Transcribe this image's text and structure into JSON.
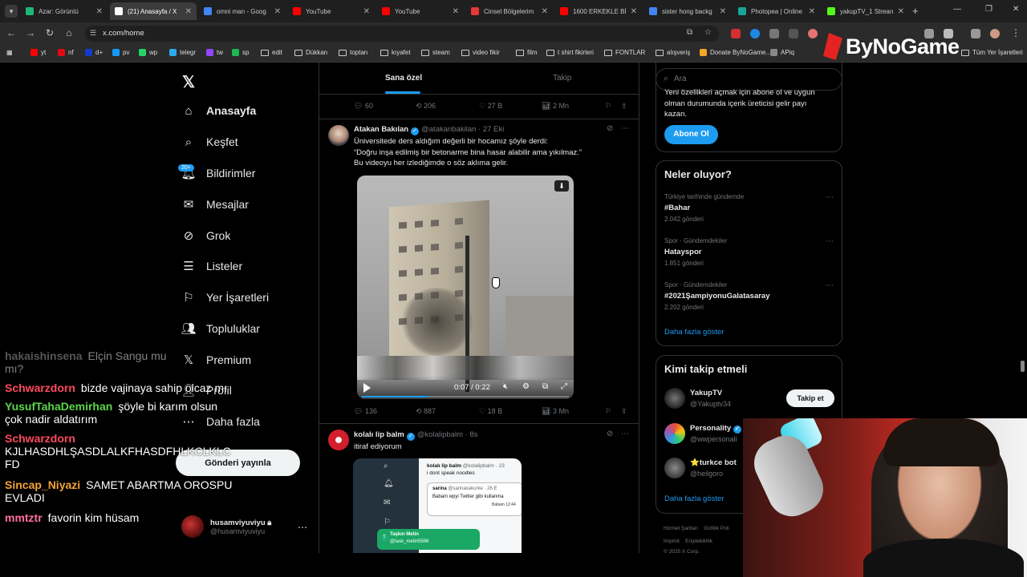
{
  "browser": {
    "tabs": [
      {
        "title": "Azar: Görüntü",
        "icon_color": "#1fb676",
        "active": false
      },
      {
        "title": "(21) Anasayfa / X",
        "icon_color": "#ffffff",
        "active": true
      },
      {
        "title": "omni man - Goog",
        "icon_color": "#4285f4",
        "active": false
      },
      {
        "title": "YouTube",
        "icon_color": "#ff0000",
        "active": false
      },
      {
        "title": "YouTube",
        "icon_color": "#ff0000",
        "active": false
      },
      {
        "title": "Cinsel Bölgelerim",
        "icon_color": "#e53935",
        "active": false
      },
      {
        "title": "1600 ERKEKLE Bİ",
        "icon_color": "#ff0000",
        "active": false
      },
      {
        "title": "sister hong backg",
        "icon_color": "#4285f4",
        "active": false
      },
      {
        "title": "Photopea | Online",
        "icon_color": "#18a497",
        "active": false
      },
      {
        "title": "yakupTV_1 Strean",
        "icon_color": "#53fc18",
        "active": false
      }
    ],
    "url": "x.com/home",
    "bookmarks": [
      {
        "label": "yt",
        "type": "icon",
        "color": "#ff0000"
      },
      {
        "label": "nf",
        "type": "icon",
        "color": "#e50914"
      },
      {
        "label": "d+",
        "type": "icon",
        "color": "#113ccf"
      },
      {
        "label": "pv",
        "type": "icon",
        "color": "#1399ff"
      },
      {
        "label": "wp",
        "type": "icon",
        "color": "#25d366"
      },
      {
        "label": "telegr",
        "type": "icon",
        "color": "#2aabee"
      },
      {
        "label": "tw",
        "type": "icon",
        "color": "#9146ff"
      },
      {
        "label": "sp",
        "type": "icon",
        "color": "#1db954"
      },
      {
        "label": "edit",
        "type": "folder"
      },
      {
        "label": "Dükkan",
        "type": "folder"
      },
      {
        "label": "toptan",
        "type": "folder"
      },
      {
        "label": "kıyafet",
        "type": "folder"
      },
      {
        "label": "steam",
        "type": "folder"
      },
      {
        "label": "video fikir",
        "type": "folder"
      },
      {
        "label": "film",
        "type": "folder"
      },
      {
        "label": "t shirt fikirleri",
        "type": "folder"
      },
      {
        "label": "FONTLAR",
        "type": "folder"
      },
      {
        "label": "alışveriş",
        "type": "folder"
      },
      {
        "label": "Donate ByNoGame...",
        "type": "icon",
        "color": "#f5a623"
      },
      {
        "label": "APiq",
        "type": "icon",
        "color": "#888888"
      }
    ],
    "all_bookmarks": "Tüm Yer İşaretleri",
    "overlay_logo": "ByNoGame"
  },
  "nav": {
    "items": [
      {
        "label": "Anasayfa",
        "icon": "home-icon",
        "glyph": "⌂",
        "bold": true
      },
      {
        "label": "Keşfet",
        "icon": "search-icon",
        "glyph": "⌕"
      },
      {
        "label": "Bildirimler",
        "icon": "bell-icon",
        "glyph": "🔔︎"
      },
      {
        "label": "Mesajlar",
        "icon": "mail-icon",
        "glyph": "✉"
      },
      {
        "label": "Grok",
        "icon": "grok-icon",
        "glyph": "⊘"
      },
      {
        "label": "Listeler",
        "icon": "list-icon",
        "glyph": "☰"
      },
      {
        "label": "Yer İşaretleri",
        "icon": "bookmark-icon",
        "glyph": "⚐"
      },
      {
        "label": "Topluluklar",
        "icon": "communities-icon",
        "glyph": "👥︎"
      },
      {
        "label": "Premium",
        "icon": "x-premium-icon",
        "glyph": "𝕏"
      },
      {
        "label": "Profil",
        "icon": "profile-icon",
        "glyph": "👤︎"
      },
      {
        "label": "Daha fazla",
        "icon": "more-icon",
        "glyph": "⋯"
      }
    ],
    "badge": "20+",
    "post_button": "Gönderi yayınla",
    "account": {
      "name": "husamviyuviyu",
      "handle": "@husamviyuviyu"
    }
  },
  "timeline": {
    "tabs": [
      "Sana özel",
      "Takip"
    ],
    "prev_actions": {
      "replies": "60",
      "reposts": "206",
      "likes": "27 B",
      "views": "2 Mn"
    },
    "tweet1": {
      "name": "Atakan Bakılan",
      "handle": "@atakanbakilan",
      "time": "· 27 Eki",
      "lines": [
        "Üniversitede ders aldığım değerli bir hocamız şöyle derdi:",
        "“Doğru inşa edilmiş bir betonarme bina hasar alabilir ama yıkılmaz.”",
        "Bu videoyu her izlediğimde o söz aklıma gelir."
      ],
      "video_time": "0:07 / 0:22",
      "video_progress": 0.32,
      "actions": {
        "replies": "136",
        "reposts": "887",
        "likes": "18 B",
        "views": "3 Mn"
      }
    },
    "tweet2": {
      "name": "kolalı lip balm",
      "handle": "@kolalipbalm",
      "time": "· 8s",
      "text": "itiraf ediyorum",
      "shot": {
        "name": "kolalı lip balm",
        "handle": "@kolalipbalm · 23",
        "line": "i dont speak noodles",
        "inner_name": "sarina",
        "inner_handle": "@sarinaxakurke · 26 E",
        "inner_text": "Babam wpyi Twitter gibi kullanma",
        "chat_name": "Taşkın Metin",
        "chat_handle": "@task_metin5596",
        "chat_initial": "T",
        "side_label_1": "Babam",
        "side_label_2": "12:44"
      }
    }
  },
  "right": {
    "search_placeholder": "Ara",
    "premium": {
      "lines": [
        "Yeni özellikleri açmak için abone ol ve uygun",
        "olman durumunda içerik üreticisi gelir payı",
        "kazan."
      ],
      "button": "Abone Ol"
    },
    "trends": {
      "title": "Neler oluyor?",
      "items": [
        {
          "context": "Türkiye tarihinde gündemde",
          "topic": "#Bahar",
          "count": "2.042 gönderi"
        },
        {
          "context": "Spor · Gündemdekiler",
          "topic": "Hatayspor",
          "count": "1.851 gönderi"
        },
        {
          "context": "Spor · Gündemdekiler",
          "topic": "#2021ŞampiyonuGalatasaray",
          "count": "2.202 gönderi"
        }
      ],
      "more": "Daha fazla göster"
    },
    "who_to_follow": {
      "title": "Kimi takip etmeli",
      "items": [
        {
          "name": "YakupTV",
          "handle": "@Yakuptv34",
          "button": "Takip et"
        },
        {
          "name": "Personality",
          "handle": "@wwpersonali",
          "button": ""
        },
        {
          "name": "⭐turkce bot",
          "handle": "@heilgoro",
          "button": ""
        }
      ],
      "more": "Daha fazla göster"
    },
    "footer": {
      "l1a": "Hizmet Şartları",
      "l1b": "Gizlilik Poli",
      "l2a": "Imprint",
      "l2b": "Erişilebilirlik",
      "l3": "© 2025 X Corp."
    }
  },
  "chat": [
    {
      "user": "hakaishinsena",
      "msg": "Elçin Sangu mu",
      "color": "#aaaaaa",
      "cont": "mı?",
      "faded": true
    },
    {
      "user": "Schwarzdorn",
      "msg": "bizde vajinaya sahip olcaz mı",
      "color": "#ff4a5e"
    },
    {
      "user": "YusufTahaDemirhan",
      "msg": "şöyle bi karım olsun",
      "color": "#5cd64b",
      "cont": "çok nadir aldatırım"
    },
    {
      "user": "Schwarzdorn",
      "msg": "",
      "color": "#ff4a5e",
      "cont": "KJLHASDHLŞASDLALKFHASDFHLKCLKLC",
      "cont2": "FD"
    },
    {
      "user": "Sincap_Niyazi",
      "msg": "SAMET ABARTMA OROSPU",
      "color": "#f2a33a",
      "cont": "EVLADI"
    },
    {
      "user": "mmtztr",
      "msg": "favorin kim hüsam",
      "color": "#ff6fa1"
    }
  ]
}
